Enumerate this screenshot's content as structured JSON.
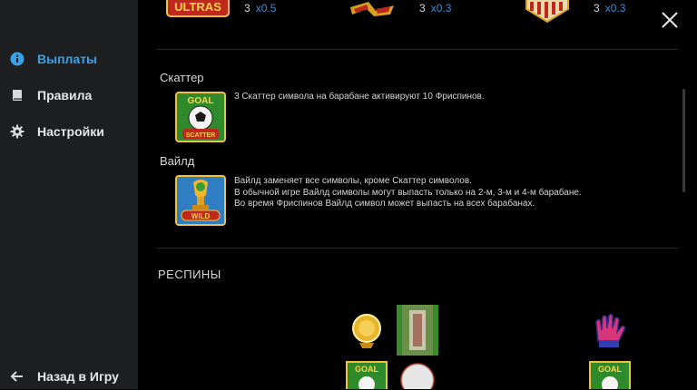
{
  "sidebar": {
    "items": [
      {
        "label": "Выплаты",
        "icon": "info-icon",
        "active": true
      },
      {
        "label": "Правила",
        "icon": "book-icon",
        "active": false
      },
      {
        "label": "Настройки",
        "icon": "gear-icon",
        "active": false
      }
    ],
    "back_label": "Назад в Игру",
    "back_icon": "arrow-left-icon"
  },
  "top_paytable": [
    {
      "symbol_text": "ULTRAS",
      "count": "3",
      "multiplier": "x0.5"
    },
    {
      "symbol_text": "",
      "count": "3",
      "multiplier": "x0.3"
    },
    {
      "symbol_text": "",
      "count": "3",
      "multiplier": "x0.3"
    }
  ],
  "scatter": {
    "title": "Скаттер",
    "description": "3 Скаттер символа на барабане активируют 10 Фриспинов.",
    "tile_top": "GOAL",
    "tile_bottom": "SCATTER"
  },
  "wild": {
    "title": "Вайлд",
    "lines": [
      "Вайлд заменяет все символы, кроме Скаттер символов.",
      "В обычной игре Вайлд символы могут выпасть только на 2-м, 3-м и 4-м барабане.",
      "Во время Фриспинов Вайлд символ может выпасть на всех барабанах."
    ],
    "tile_label": "WILD"
  },
  "respins": {
    "title": "РЕСПИНЫ",
    "grid_labels": [
      "GOAL",
      "GOAL"
    ]
  },
  "colors": {
    "accent": "#3aa0e8",
    "sidebar_bg": "#1e1f21",
    "main_bg": "#000000",
    "multiplier": "#3a8fd6"
  }
}
